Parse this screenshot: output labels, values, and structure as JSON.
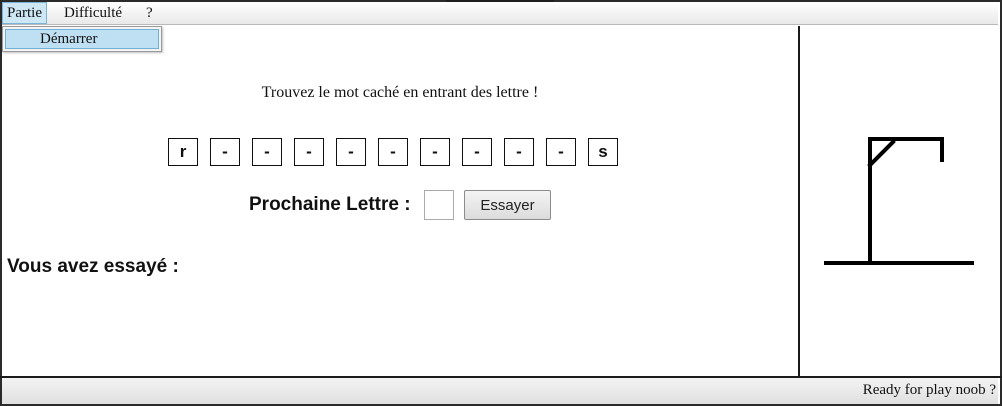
{
  "menu": {
    "items": [
      {
        "label": "Partie"
      },
      {
        "label": "Difficulté"
      },
      {
        "label": "?"
      }
    ],
    "open_menu": {
      "items": [
        {
          "label": "Démarrer"
        }
      ]
    }
  },
  "game": {
    "instruction": "Trouvez le mot caché en entrant des lettre !",
    "letters": [
      "r",
      "-",
      "-",
      "-",
      "-",
      "-",
      "-",
      "-",
      "-",
      "-",
      "s"
    ],
    "next_letter_label": "Prochaine Lettre :",
    "next_letter_value": "",
    "try_button_label": "Essayer",
    "tried_label": "Vous avez essayé :",
    "tried_letters": ""
  },
  "hangman": {
    "icon": "gallows-icon",
    "stroke_color": "#000000",
    "stage": "gallows"
  },
  "status": {
    "text": "Ready for play noob ?"
  }
}
